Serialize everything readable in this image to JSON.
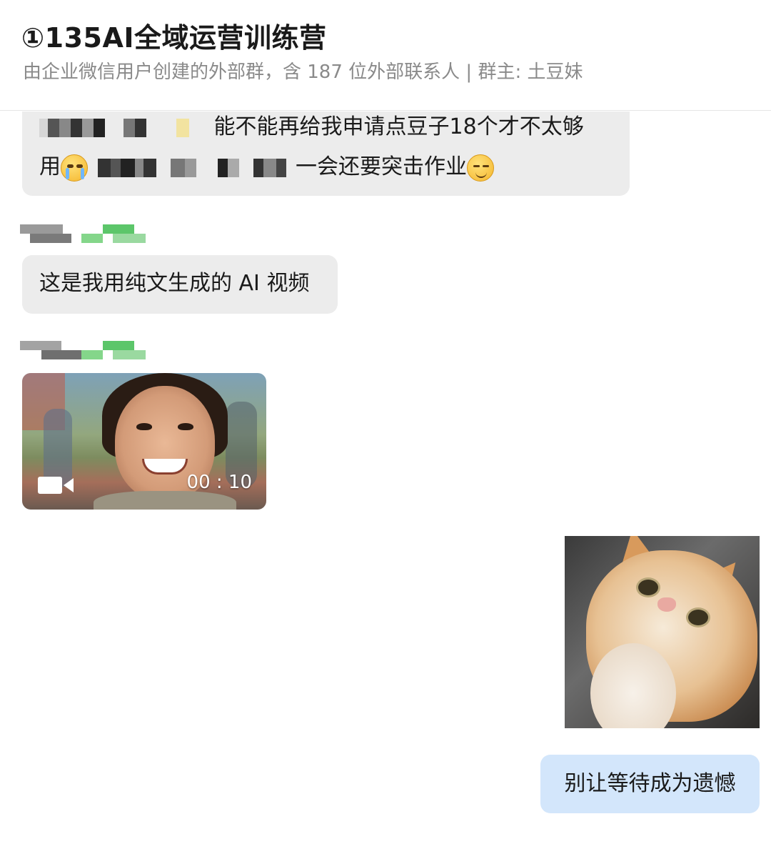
{
  "header": {
    "title": "①135AI全域运营训练营",
    "subtitle": "由企业微信用户创建的外部群，含 187 位外部联系人 | 群主: 土豆妹"
  },
  "messages": {
    "msg1": {
      "line1_text": "能不能再给我申请点豆子18个才不太够",
      "line2_prefix": "用",
      "line2_suffix": "一会还要突击作业",
      "emoji_1": "crying-face-emoji",
      "emoji_2": "smirking-face-emoji"
    },
    "msg2": {
      "text": "这是我用纯文生成的 AI 视频"
    },
    "video": {
      "duration": "00 : 10",
      "icon": "video-camera-icon"
    },
    "mine": {
      "text": "别让等待成为遗憾"
    }
  }
}
